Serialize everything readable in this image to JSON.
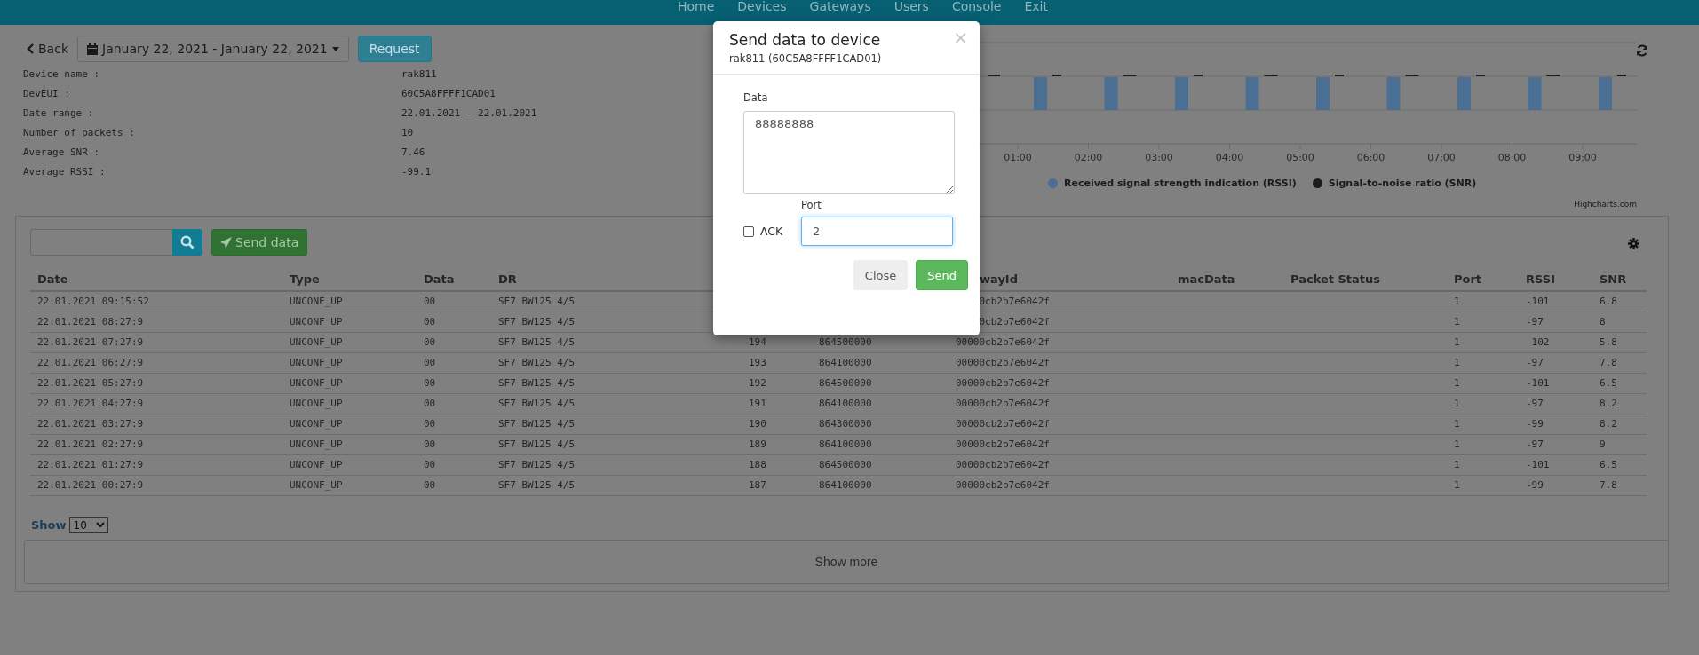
{
  "nav": {
    "items": [
      "Home",
      "Devices",
      "Gateways",
      "Users",
      "Console",
      "Exit"
    ]
  },
  "toolbar": {
    "back": "Back",
    "date_range": "January 22, 2021 - January 22, 2021",
    "request": "Request"
  },
  "device_info": [
    {
      "label": "Device name :",
      "value": "rak811"
    },
    {
      "label": "DevEUI :",
      "value": "60C5A8FFFF1CAD01"
    },
    {
      "label": "Date range :",
      "value": "22.01.2021 - 22.01.2021"
    },
    {
      "label": "Number of packets :",
      "value": "10"
    },
    {
      "label": "Average SNR :",
      "value": "7.46"
    },
    {
      "label": "Average RSSI :",
      "value": "-99.1"
    }
  ],
  "chart": {
    "x_labels": [
      "01:00",
      "02:00",
      "03:00",
      "04:00",
      "05:00",
      "06:00",
      "07:00",
      "08:00",
      "09:00"
    ],
    "legend": [
      {
        "label": "Received signal strength indication (RSSI)",
        "color": "#4a6f93"
      },
      {
        "label": "Signal-to-noise ratio (SNR)",
        "color": "#1c1c1c"
      }
    ],
    "credit": "Highcharts.com"
  },
  "packets": {
    "send_button": "Send data",
    "columns": [
      "Date",
      "Type",
      "Data",
      "DR",
      "",
      "",
      "wayId",
      "macData",
      "Packet Status",
      "Port",
      "RSSI",
      "SNR"
    ],
    "rows": [
      [
        "22.01.2021 09:15:52",
        "UNCONF_UP",
        "00",
        "SF7 BW125 4/5",
        "",
        "",
        "0cb2b7e6042f",
        "",
        "",
        "1",
        "-101",
        "6.8"
      ],
      [
        "22.01.2021 08:27:9",
        "UNCONF_UP",
        "00",
        "SF7 BW125 4/5",
        "",
        "",
        "0cb2b7e6042f",
        "",
        "",
        "1",
        "-97",
        "8"
      ],
      [
        "22.01.2021 07:27:9",
        "UNCONF_UP",
        "00",
        "SF7 BW125 4/5",
        "194",
        "864500000",
        "00000cb2b7e6042f",
        "",
        "",
        "1",
        "-102",
        "5.8"
      ],
      [
        "22.01.2021 06:27:9",
        "UNCONF_UP",
        "00",
        "SF7 BW125 4/5",
        "193",
        "864100000",
        "00000cb2b7e6042f",
        "",
        "",
        "1",
        "-97",
        "7.8"
      ],
      [
        "22.01.2021 05:27:9",
        "UNCONF_UP",
        "00",
        "SF7 BW125 4/5",
        "192",
        "864500000",
        "00000cb2b7e6042f",
        "",
        "",
        "1",
        "-101",
        "6.5"
      ],
      [
        "22.01.2021 04:27:9",
        "UNCONF_UP",
        "00",
        "SF7 BW125 4/5",
        "191",
        "864100000",
        "00000cb2b7e6042f",
        "",
        "",
        "1",
        "-97",
        "8.2"
      ],
      [
        "22.01.2021 03:27:9",
        "UNCONF_UP",
        "00",
        "SF7 BW125 4/5",
        "190",
        "864300000",
        "00000cb2b7e6042f",
        "",
        "",
        "1",
        "-99",
        "8.2"
      ],
      [
        "22.01.2021 02:27:9",
        "UNCONF_UP",
        "00",
        "SF7 BW125 4/5",
        "189",
        "864100000",
        "00000cb2b7e6042f",
        "",
        "",
        "1",
        "-97",
        "9"
      ],
      [
        "22.01.2021 01:27:9",
        "UNCONF_UP",
        "00",
        "SF7 BW125 4/5",
        "188",
        "864500000",
        "00000cb2b7e6042f",
        "",
        "",
        "1",
        "-101",
        "6.5"
      ],
      [
        "22.01.2021 00:27:9",
        "UNCONF_UP",
        "00",
        "SF7 BW125 4/5",
        "187",
        "864100000",
        "00000cb2b7e6042f",
        "",
        "",
        "1",
        "-99",
        "7.8"
      ]
    ],
    "show_label": "Show",
    "page_size": "10",
    "show_more": "Show more"
  },
  "modal": {
    "title": "Send data to device",
    "subtitle": "rak811 (60C5A8FFFF1CAD01)",
    "close_glyph": "×",
    "data_label": "Data",
    "data_value": "88888888",
    "ack": {
      "label": "ACK",
      "checked": false
    },
    "port_label": "Port",
    "port_value": "2",
    "buttons": [
      {
        "label": "Close",
        "kind": "default"
      },
      {
        "label": "Send",
        "kind": "success"
      }
    ]
  }
}
